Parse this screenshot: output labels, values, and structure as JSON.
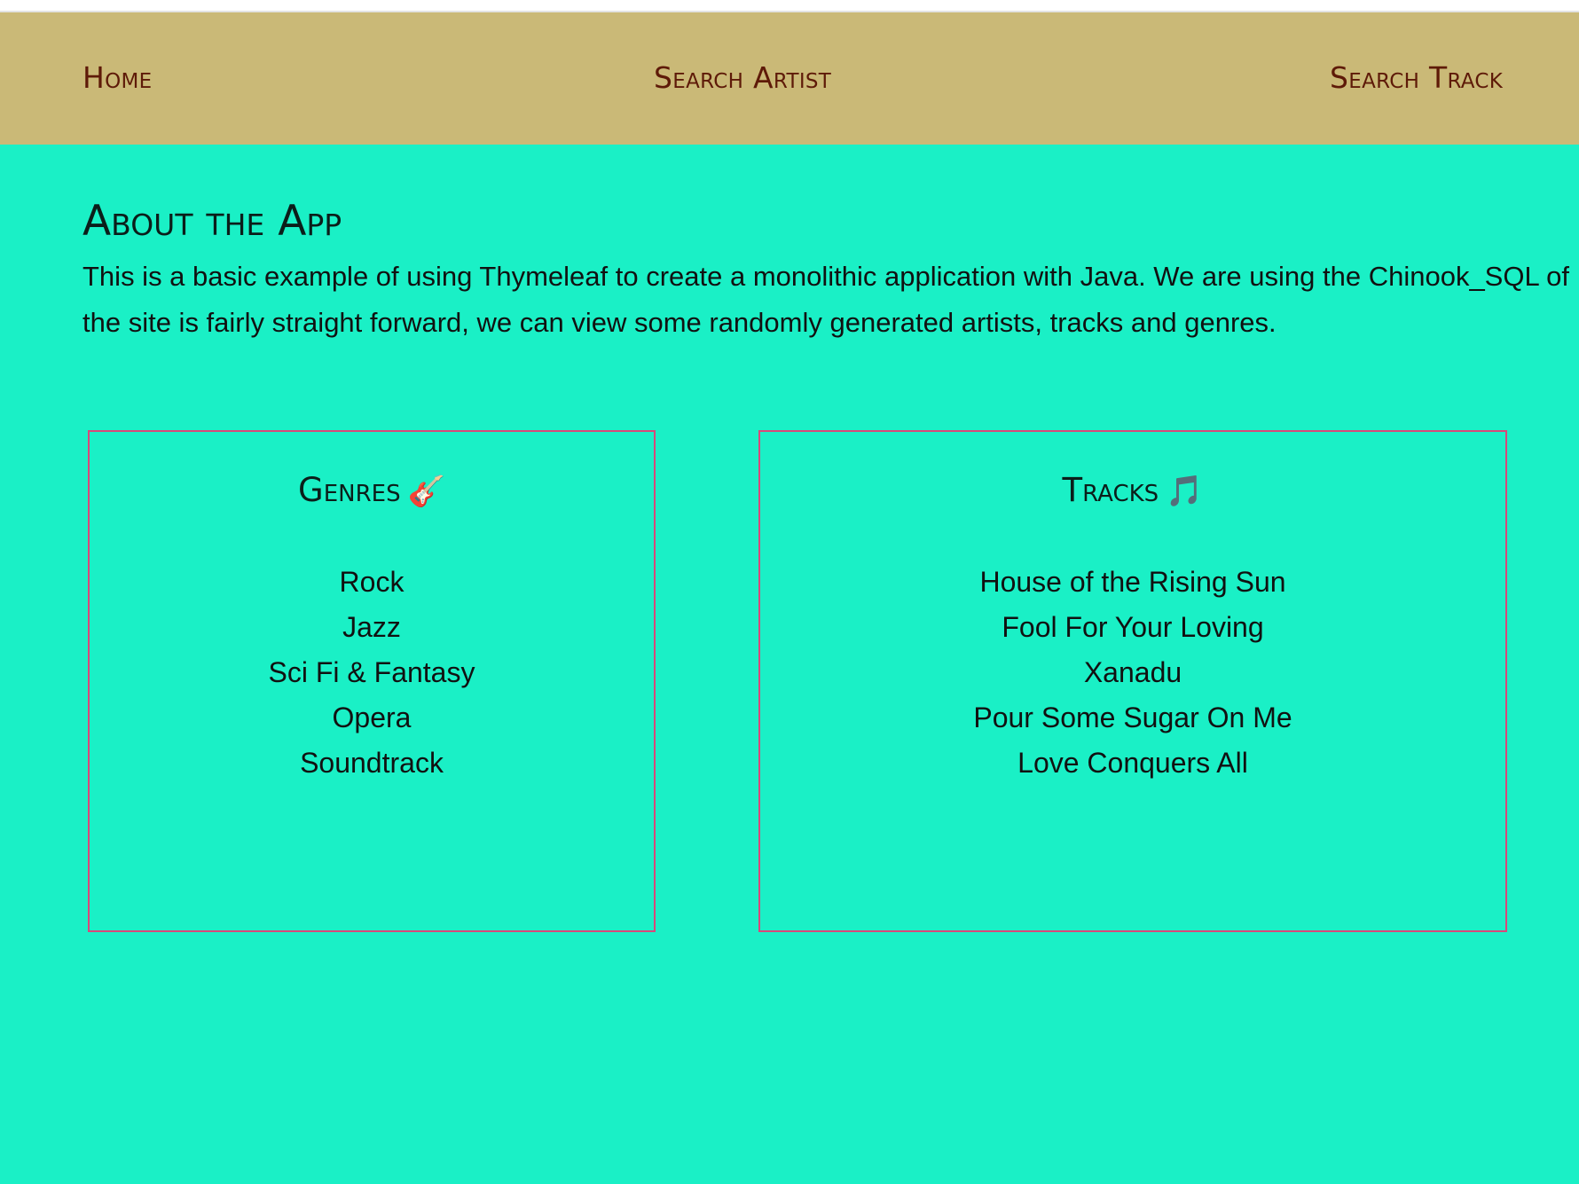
{
  "nav": {
    "home": "Home",
    "search_artist": "Search Artist",
    "search_track": "Search Track"
  },
  "about": {
    "title": "About the App",
    "text": "This is a basic example of using Thymeleaf to create a monolithic application with Java. We are using the Chinook_SQL of the site is fairly straight forward, we can view some randomly generated artists, tracks and genres."
  },
  "genres": {
    "title": "Genres",
    "icon": "guitar-icon",
    "icon_glyph": "🎸",
    "items": [
      "Rock",
      "Jazz",
      "Sci Fi & Fantasy",
      "Opera",
      "Soundtrack"
    ]
  },
  "tracks": {
    "title": "Tracks",
    "icon": "music-note-icon",
    "icon_glyph": "🎵",
    "items": [
      "House of the Rising Sun",
      "Fool For Your Loving",
      "Xanadu",
      "Pour Some Sugar On Me",
      "Love Conquers All"
    ]
  },
  "colors": {
    "background": "#1af0c6",
    "navbar": "#cab977",
    "nav_text": "#5e1a08",
    "box_border": "#d9487a"
  }
}
